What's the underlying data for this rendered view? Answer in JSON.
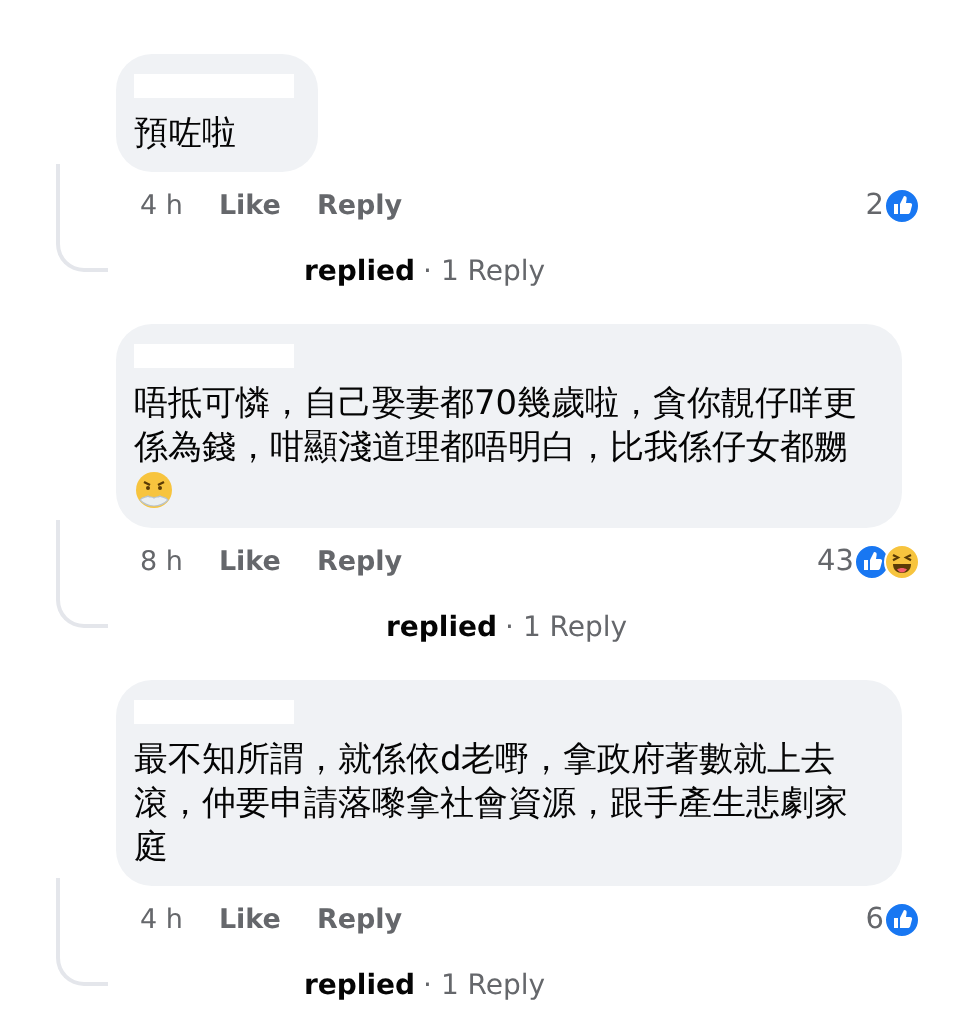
{
  "comments": [
    {
      "text": "預咗啦",
      "time": "4 h",
      "like": "Like",
      "reply": "Reply",
      "reaction_count": "2",
      "reactions": [
        {
          "kind": "like"
        }
      ],
      "replies_author": "replied",
      "replies_link": "· 1 Reply"
    },
    {
      "text": "唔抵可憐，自己娶妻都70幾歲啦，貪你靚仔咩更係為錢，咁顯淺道理都唔明白，比我係仔女都嬲",
      "emoji": {
        "kind": "steam"
      },
      "time": "8 h",
      "like": "Like",
      "reply": "Reply",
      "reaction_count": "43",
      "reactions": [
        {
          "kind": "like"
        },
        {
          "kind": "haha"
        }
      ],
      "replies_author": "replied",
      "replies_link": "· 1 Reply"
    },
    {
      "text": "最不知所謂，就係依d老嘢，拿政府著數就上去滾，仲要申請落嚟拿社會資源，跟手產生悲劇家庭",
      "time": "4 h",
      "like": "Like",
      "reply": "Reply",
      "reaction_count": "6",
      "reactions": [
        {
          "kind": "like"
        }
      ],
      "replies_author": "replied",
      "replies_link": "· 1 Reply"
    }
  ]
}
